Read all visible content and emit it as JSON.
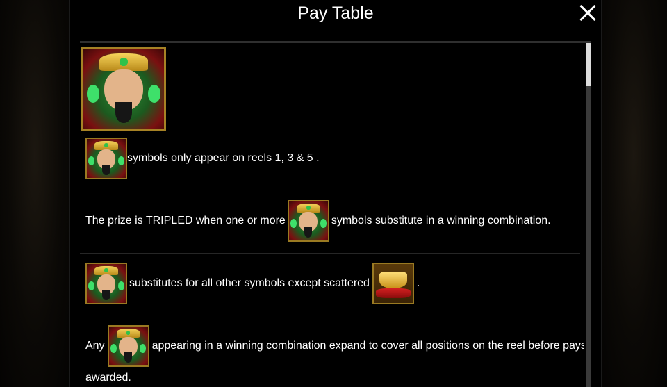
{
  "dialog": {
    "title": "Pay Table"
  },
  "symbols": {
    "wild": "wild-emperor-symbol",
    "scatter": "gold-ingot-scatter-symbol"
  },
  "rules": {
    "reels": {
      "text": "symbols only appear on reels 1, 3 & 5 ."
    },
    "tripled": {
      "before": "The prize is TRIPLED when one or more",
      "after": "symbols substitute in a winning combination."
    },
    "substitutes": {
      "before": "substitutes for all other symbols except scattered",
      "after": "."
    },
    "expand": {
      "before": "Any",
      "after": "appearing in a winning combination expand to cover all positions on the reel before pays are",
      "line2": "awarded."
    }
  },
  "scroll": {
    "position": 0
  }
}
